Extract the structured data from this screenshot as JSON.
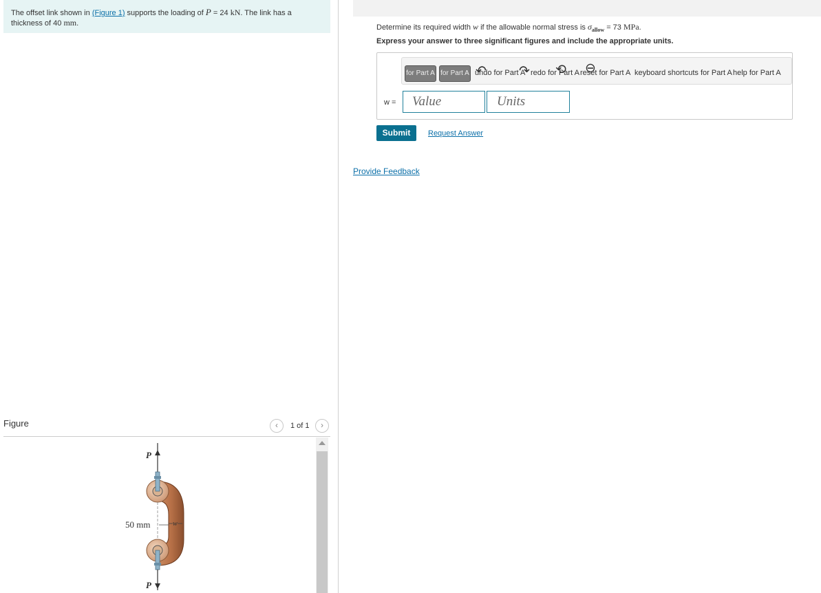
{
  "problem": {
    "text_1": "The offset link shown in ",
    "figure_link": "(Figure 1)",
    "text_2": " supports the loading of ",
    "var_p": "P",
    "text_3": " = 24 ",
    "unit_kn": "kN",
    "text_4": ". The link has a thickness of 40 ",
    "unit_mm": "mm",
    "text_5": "."
  },
  "figure_panel": {
    "title": "Figure",
    "page_count": "1 of 1",
    "prev_icon": "‹",
    "next_icon": "›",
    "labels": {
      "p_top": "P",
      "p_bottom": "P",
      "dimension": "50 mm",
      "width": "w"
    }
  },
  "part_a": {
    "question_1": "Determine its required width ",
    "var_w": "w",
    "question_2": " if the allowable normal stress is ",
    "sigma": "σ",
    "sigma_sub": "allow",
    "question_3": " = 73 ",
    "unit_mpa": "MPa",
    "question_4": ".",
    "instruction": "Express your answer to three significant figures and include the appropriate units."
  },
  "toolbar": {
    "btn1": "for Part A",
    "btn2": "for Part A",
    "undo": "undo for Part A",
    "redo": "redo for Part A",
    "reset": "reset for Part A",
    "keyboard": "keyboard shortcuts for Part A",
    "help": "help for Part A"
  },
  "answer": {
    "w_label": "w =",
    "value_placeholder": "Value",
    "units_placeholder": "Units"
  },
  "actions": {
    "submit": "Submit",
    "request_answer": "Request Answer",
    "provide_feedback": "Provide Feedback"
  }
}
